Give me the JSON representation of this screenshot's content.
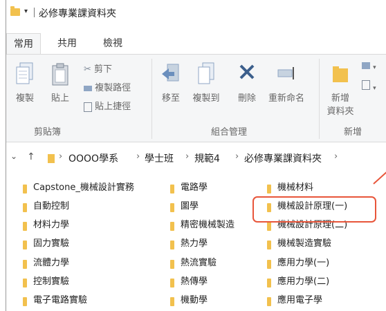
{
  "window": {
    "title": "必修專業課資料夾",
    "qa_arrow": "▾"
  },
  "tabs": [
    "常用",
    "共用",
    "檢視"
  ],
  "ribbon": {
    "copy": "複製",
    "paste": "貼上",
    "cut": "剪下",
    "copy_path": "複製路徑",
    "paste_shortcut": "貼上捷徑",
    "move_to": "移至",
    "copy_to": "複製到",
    "delete": "刪除",
    "rename": "重新命名",
    "new_folder_l1": "新增",
    "new_folder_l2": "資料夾",
    "group_clipboard": "剪貼簿",
    "group_organize": "組合管理",
    "group_new": "新增"
  },
  "address": {
    "segments": [
      "OOOO學系",
      "學士班",
      "規範4",
      "必修專業課資料夾"
    ]
  },
  "files": {
    "col1": [
      "Capstone_機械設計實務",
      "自動控制",
      "材料力學",
      "固力實驗",
      "流體力學",
      "控制實驗",
      "電子電路實驗"
    ],
    "col2": [
      "電路學",
      "圖學",
      "精密機械製造",
      "熱力學",
      "熱流實驗",
      "熱傳學",
      "機動學"
    ],
    "col3": [
      "機械材料",
      "機械設計原理(一)",
      "機械設計原理(二)",
      "機械製造實驗",
      "應用力學(一)",
      "應用力學(二)",
      "應用電子學"
    ]
  },
  "colors": {
    "folder": "#f2c14e",
    "highlight": "#e8553a",
    "ribbon_bg": "#f5f6f7"
  }
}
